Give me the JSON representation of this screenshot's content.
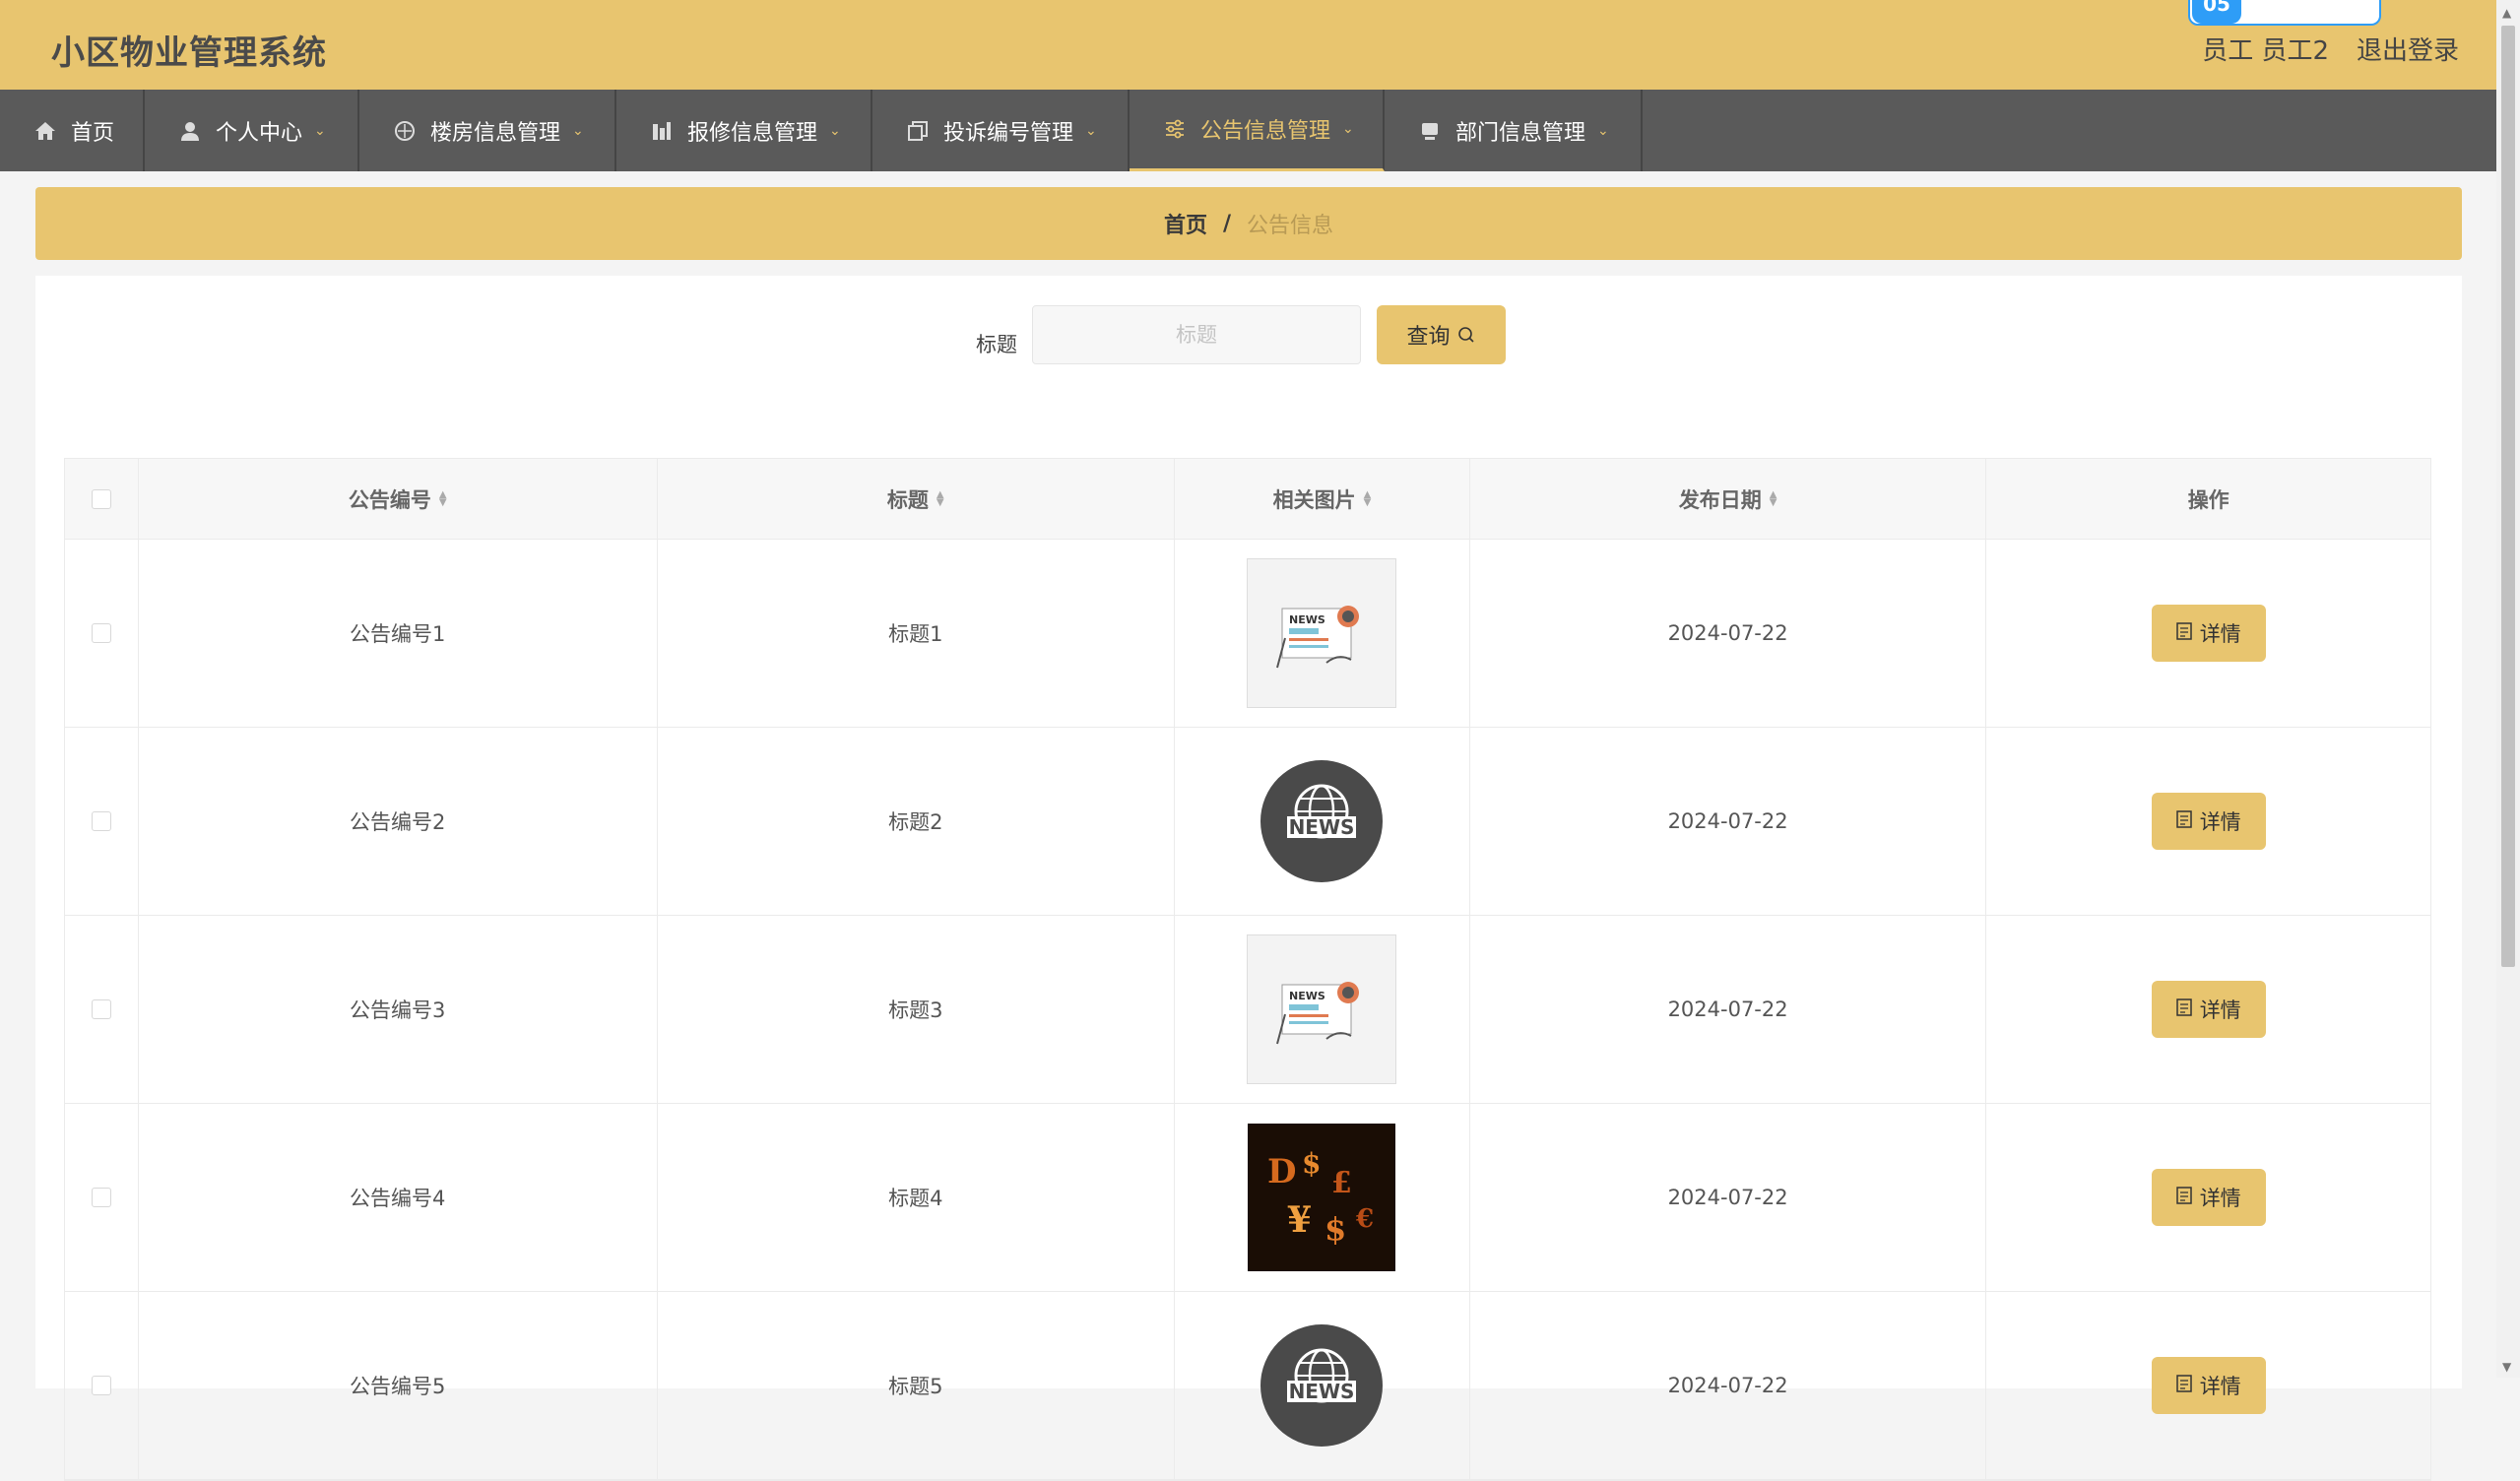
{
  "header": {
    "title": "小区物业管理系统",
    "user": "员工 员工2",
    "logout": "退出登录",
    "float_badge": "05"
  },
  "nav": [
    {
      "label": "首页",
      "icon": "home-icon",
      "has_dropdown": false
    },
    {
      "label": "个人中心",
      "icon": "user-icon",
      "has_dropdown": true
    },
    {
      "label": "楼房信息管理",
      "icon": "compass-icon",
      "has_dropdown": true
    },
    {
      "label": "报修信息管理",
      "icon": "bar-chart-icon",
      "has_dropdown": true
    },
    {
      "label": "投诉编号管理",
      "icon": "copy-icon",
      "has_dropdown": true
    },
    {
      "label": "公告信息管理",
      "icon": "sliders-icon",
      "has_dropdown": true,
      "active": true
    },
    {
      "label": "部门信息管理",
      "icon": "monitor-icon",
      "has_dropdown": true
    }
  ],
  "breadcrumb": {
    "home": "首页",
    "sep": "/",
    "current": "公告信息"
  },
  "search": {
    "label": "标题",
    "placeholder": "标题",
    "button": "查询"
  },
  "table": {
    "headers": [
      "公告编号",
      "标题",
      "相关图片",
      "发布日期",
      "操作"
    ],
    "rows": [
      {
        "code": "公告编号1",
        "title": "标题1",
        "image": "news-paper",
        "date": "2024-07-22",
        "action": "详情"
      },
      {
        "code": "公告编号2",
        "title": "标题2",
        "image": "news-globe",
        "date": "2024-07-22",
        "action": "详情"
      },
      {
        "code": "公告编号3",
        "title": "标题3",
        "image": "news-paper",
        "date": "2024-07-22",
        "action": "详情"
      },
      {
        "code": "公告编号4",
        "title": "标题4",
        "image": "currency",
        "date": "2024-07-22",
        "action": "详情"
      },
      {
        "code": "公告编号5",
        "title": "标题5",
        "image": "news-globe",
        "date": "2024-07-22",
        "action": "详情"
      }
    ]
  },
  "colors": {
    "accent": "#e8c56f",
    "nav_bg": "#5a5a5a",
    "active_text": "#e8c56f"
  }
}
